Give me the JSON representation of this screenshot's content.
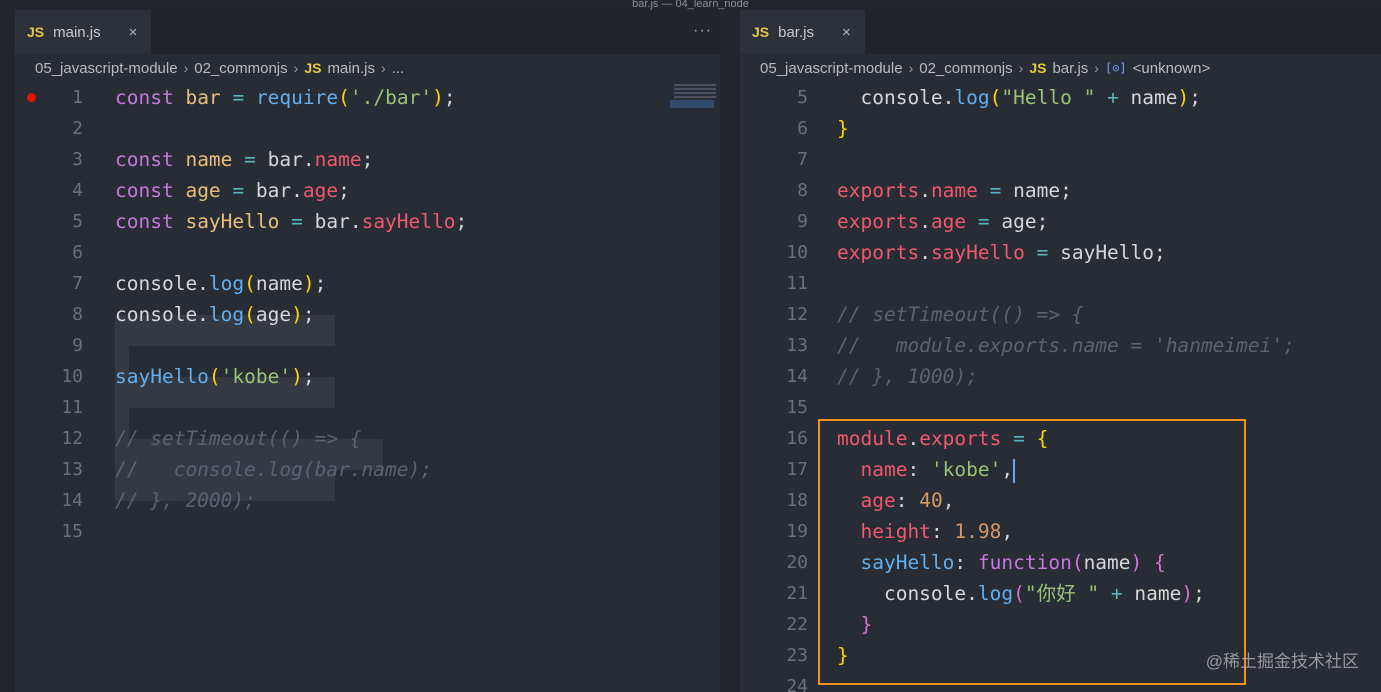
{
  "window": {
    "title": "bar.js — 04_learn_node"
  },
  "left_editor": {
    "tab": {
      "icon": "JS",
      "label": "main.js",
      "close": "×"
    },
    "more_actions": "···",
    "breadcrumb": {
      "folder1": "05_javascript-module",
      "folder2": "02_commonjs",
      "file_icon": "JS",
      "file": "main.js",
      "tail": "..."
    },
    "lines": [
      {
        "n": "1",
        "tokens": [
          [
            "kw",
            "const"
          ],
          [
            "pl",
            " "
          ],
          [
            "var",
            "bar"
          ],
          [
            "pl",
            " "
          ],
          [
            "op",
            "="
          ],
          [
            "pl",
            " "
          ],
          [
            "fn",
            "require"
          ],
          [
            "p1",
            "("
          ],
          [
            "str",
            "'./bar'"
          ],
          [
            "p1",
            ")"
          ],
          [
            "pl",
            ";"
          ]
        ]
      },
      {
        "n": "2",
        "tokens": []
      },
      {
        "n": "3",
        "tokens": [
          [
            "kw",
            "const"
          ],
          [
            "pl",
            " "
          ],
          [
            "var",
            "name"
          ],
          [
            "pl",
            " "
          ],
          [
            "op",
            "="
          ],
          [
            "pl",
            " bar."
          ],
          [
            "prop",
            "name"
          ],
          [
            "pl",
            ";"
          ]
        ]
      },
      {
        "n": "4",
        "tokens": [
          [
            "kw",
            "const"
          ],
          [
            "pl",
            " "
          ],
          [
            "var",
            "age"
          ],
          [
            "pl",
            " "
          ],
          [
            "op",
            "="
          ],
          [
            "pl",
            " bar."
          ],
          [
            "prop",
            "age"
          ],
          [
            "pl",
            ";"
          ]
        ]
      },
      {
        "n": "5",
        "tokens": [
          [
            "kw",
            "const"
          ],
          [
            "pl",
            " "
          ],
          [
            "var",
            "sayHello"
          ],
          [
            "pl",
            " "
          ],
          [
            "op",
            "="
          ],
          [
            "pl",
            " bar."
          ],
          [
            "prop",
            "sayHello"
          ],
          [
            "pl",
            ";"
          ]
        ]
      },
      {
        "n": "6",
        "tokens": []
      },
      {
        "n": "7",
        "tokens": [
          [
            "pl",
            "console."
          ],
          [
            "fn",
            "log"
          ],
          [
            "p1",
            "("
          ],
          [
            "pl",
            "name"
          ],
          [
            "p1",
            ")"
          ],
          [
            "pl",
            ";"
          ]
        ]
      },
      {
        "n": "8",
        "tokens": [
          [
            "pl",
            "console."
          ],
          [
            "fn",
            "log"
          ],
          [
            "p1",
            "("
          ],
          [
            "pl",
            "age"
          ],
          [
            "p1",
            ")"
          ],
          [
            "pl",
            ";"
          ]
        ]
      },
      {
        "n": "9",
        "tokens": []
      },
      {
        "n": "10",
        "tokens": [
          [
            "fn",
            "sayHello"
          ],
          [
            "p1",
            "("
          ],
          [
            "str",
            "'kobe'"
          ],
          [
            "p1",
            ")"
          ],
          [
            "pl",
            ";"
          ]
        ]
      },
      {
        "n": "11",
        "tokens": []
      },
      {
        "n": "12",
        "tokens": [
          [
            "cm",
            "// setTimeout(() => {"
          ]
        ]
      },
      {
        "n": "13",
        "tokens": [
          [
            "cm",
            "//   console.log(bar.name);"
          ]
        ]
      },
      {
        "n": "14",
        "tokens": [
          [
            "cm",
            "// }, 2000);"
          ]
        ]
      },
      {
        "n": "15",
        "tokens": []
      }
    ]
  },
  "right_editor": {
    "tab": {
      "icon": "JS",
      "label": "bar.js",
      "close": "×"
    },
    "breadcrumb": {
      "folder1": "05_javascript-module",
      "folder2": "02_commonjs",
      "file_icon": "JS",
      "file": "bar.js",
      "symbol_icon": "[⊙]",
      "symbol": "<unknown>"
    },
    "lines": [
      {
        "n": "5",
        "tokens": [
          [
            "pl",
            "  console."
          ],
          [
            "fn",
            "log"
          ],
          [
            "p1",
            "("
          ],
          [
            "str",
            "\"Hello \""
          ],
          [
            "pl",
            " "
          ],
          [
            "op",
            "+"
          ],
          [
            "pl",
            " name"
          ],
          [
            "p1",
            ")"
          ],
          [
            "pl",
            ";"
          ]
        ]
      },
      {
        "n": "6",
        "tokens": [
          [
            "p1",
            "}"
          ]
        ]
      },
      {
        "n": "7",
        "tokens": []
      },
      {
        "n": "8",
        "tokens": [
          [
            "prop",
            "exports"
          ],
          [
            "pl",
            "."
          ],
          [
            "prop",
            "name"
          ],
          [
            "pl",
            " "
          ],
          [
            "op",
            "="
          ],
          [
            "pl",
            " name;"
          ]
        ]
      },
      {
        "n": "9",
        "tokens": [
          [
            "prop",
            "exports"
          ],
          [
            "pl",
            "."
          ],
          [
            "prop",
            "age"
          ],
          [
            "pl",
            " "
          ],
          [
            "op",
            "="
          ],
          [
            "pl",
            " age;"
          ]
        ]
      },
      {
        "n": "10",
        "tokens": [
          [
            "prop",
            "exports"
          ],
          [
            "pl",
            "."
          ],
          [
            "prop",
            "sayHello"
          ],
          [
            "pl",
            " "
          ],
          [
            "op",
            "="
          ],
          [
            "pl",
            " sayHello;"
          ]
        ]
      },
      {
        "n": "11",
        "tokens": []
      },
      {
        "n": "12",
        "tokens": [
          [
            "cm",
            "// setTimeout(() => {"
          ]
        ]
      },
      {
        "n": "13",
        "tokens": [
          [
            "cm",
            "//   module.exports.name = 'hanmeimei';"
          ]
        ]
      },
      {
        "n": "14",
        "tokens": [
          [
            "cm",
            "// }, 1000);"
          ]
        ]
      },
      {
        "n": "15",
        "tokens": []
      },
      {
        "n": "16",
        "tokens": [
          [
            "prop",
            "module"
          ],
          [
            "pl",
            "."
          ],
          [
            "prop",
            "exports"
          ],
          [
            "pl",
            " "
          ],
          [
            "op",
            "="
          ],
          [
            "pl",
            " "
          ],
          [
            "p1",
            "{"
          ]
        ]
      },
      {
        "n": "17",
        "tokens": [
          [
            "pl",
            "  "
          ],
          [
            "prop",
            "name"
          ],
          [
            "pl",
            ": "
          ],
          [
            "str",
            "'kobe'"
          ],
          [
            "pl",
            ","
          ]
        ]
      },
      {
        "n": "18",
        "tokens": [
          [
            "pl",
            "  "
          ],
          [
            "prop",
            "age"
          ],
          [
            "pl",
            ": "
          ],
          [
            "num",
            "40"
          ],
          [
            "pl",
            ","
          ]
        ]
      },
      {
        "n": "19",
        "tokens": [
          [
            "pl",
            "  "
          ],
          [
            "prop",
            "height"
          ],
          [
            "pl",
            ": "
          ],
          [
            "num",
            "1.98"
          ],
          [
            "pl",
            ","
          ]
        ]
      },
      {
        "n": "20",
        "tokens": [
          [
            "pl",
            "  "
          ],
          [
            "fn",
            "sayHello"
          ],
          [
            "pl",
            ": "
          ],
          [
            "kw",
            "function"
          ],
          [
            "p2",
            "("
          ],
          [
            "pl",
            "name"
          ],
          [
            "p2",
            ")"
          ],
          [
            "pl",
            " "
          ],
          [
            "p2",
            "{"
          ]
        ]
      },
      {
        "n": "21",
        "tokens": [
          [
            "pl",
            "    console."
          ],
          [
            "fn",
            "log"
          ],
          [
            "p2",
            "("
          ],
          [
            "str",
            "\"你好 \""
          ],
          [
            "pl",
            " "
          ],
          [
            "op",
            "+"
          ],
          [
            "pl",
            " name"
          ],
          [
            "p2",
            ")"
          ],
          [
            "pl",
            ";"
          ]
        ]
      },
      {
        "n": "22",
        "tokens": [
          [
            "pl",
            "  "
          ],
          [
            "p2",
            "}"
          ]
        ]
      },
      {
        "n": "23",
        "tokens": [
          [
            "p1",
            "}"
          ]
        ]
      },
      {
        "n": "24",
        "tokens": []
      }
    ]
  },
  "watermark": "@稀土掘金技术社区"
}
